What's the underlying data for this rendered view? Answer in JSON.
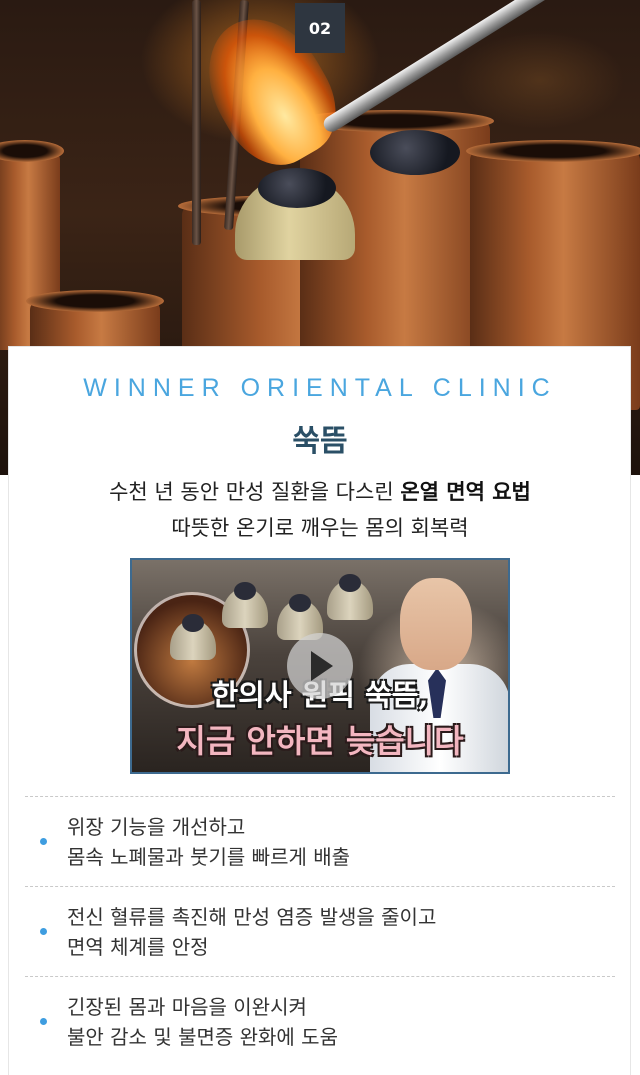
{
  "step_badge": "02",
  "clinic_name": "WINNER ORIENTAL CLINIC",
  "treatment_title": "쑥뜸",
  "intro": {
    "line1_prefix": "수천 년 동안 만성 질환을 다스린 ",
    "line1_bold": "온열 면역 요법",
    "line2": "따뜻한 온기로 깨우는 몸의 회복력"
  },
  "video": {
    "title_line1": "한의사 원픽 쑥뜸,",
    "title_line2": "지금 안하면 늦습니다",
    "play_icon": "play-icon"
  },
  "benefits": [
    {
      "line1": "위장 기능을 개선하고",
      "line2": "몸속 노폐물과 붓기를 빠르게 배출"
    },
    {
      "line1": "전신 혈류를 촉진해 만성 염증 발생을 줄이고",
      "line2": "면역 체계를 안정"
    },
    {
      "line1": "긴장된 몸과 마음을 이완시켜",
      "line2": "불안 감소 및 불면증 완화에 도움"
    }
  ],
  "colors": {
    "accent_blue": "#4aa6df",
    "title_navy": "#2a4f66",
    "bullet_blue": "#3e9de0",
    "badge_bg": "#2e3640"
  }
}
